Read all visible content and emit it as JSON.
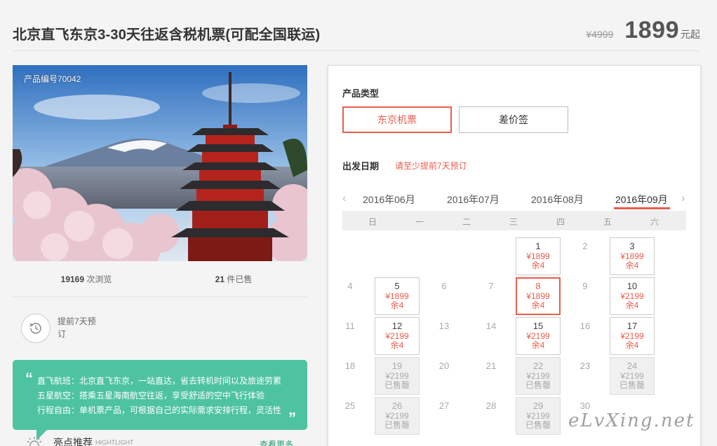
{
  "header": {
    "title": "北京直飞东京3-30天往返含税机票(可配全国联运)",
    "old_price": "¥4999",
    "price": "1899",
    "price_unit": "元起"
  },
  "product": {
    "code_label": "产品编号70042",
    "views_count": "19169",
    "views_label": " 次浏览",
    "sold_count": "21",
    "sold_label": " 件已售",
    "advance_text": "提前7天预订"
  },
  "highlights": {
    "lines": [
      "直飞航班：北京直飞东京，一站直达，省去转机时间以及旅途劳累",
      "五星航空：搭乘五星海南航空往返，享受舒适的空中飞行体验",
      "行程自由：单机票产品，可根据自己的实际需求安排行程，灵活性"
    ],
    "section_title": "亮点推荐",
    "section_en": "HIGHTLIGHT",
    "see_more": "查看更多"
  },
  "booking": {
    "type_label": "产品类型",
    "types": [
      {
        "label": "东京机票",
        "active": true
      },
      {
        "label": "差价签",
        "active": false
      }
    ],
    "date_label": "出发日期",
    "date_note": "请至少提前7天预订",
    "months": [
      "2016年06月",
      "2016年07月",
      "2016年08月",
      "2016年09月"
    ],
    "active_month": "2016年09月",
    "weekdays": [
      "日",
      "一",
      "二",
      "三",
      "四",
      "五",
      "六"
    ],
    "days": [
      {
        "d": "1",
        "col": 4,
        "row": 0,
        "state": "avail",
        "price": "¥1899",
        "left": "余4"
      },
      {
        "d": "2",
        "col": 5,
        "row": 0,
        "state": "plain"
      },
      {
        "d": "3",
        "col": 6,
        "row": 0,
        "state": "avail",
        "price": "¥1899",
        "left": "余4"
      },
      {
        "d": "4",
        "col": 0,
        "row": 1,
        "state": "plain"
      },
      {
        "d": "5",
        "col": 1,
        "row": 1,
        "state": "avail",
        "price": "¥1899",
        "left": "余4"
      },
      {
        "d": "6",
        "col": 2,
        "row": 1,
        "state": "plain"
      },
      {
        "d": "7",
        "col": 3,
        "row": 1,
        "state": "plain"
      },
      {
        "d": "8",
        "col": 4,
        "row": 1,
        "state": "selected",
        "price": "¥1899",
        "left": "余4"
      },
      {
        "d": "9",
        "col": 5,
        "row": 1,
        "state": "plain"
      },
      {
        "d": "10",
        "col": 6,
        "row": 1,
        "state": "avail",
        "price": "¥2199",
        "left": "余4"
      },
      {
        "d": "11",
        "col": 0,
        "row": 2,
        "state": "plain"
      },
      {
        "d": "12",
        "col": 1,
        "row": 2,
        "state": "avail",
        "price": "¥2199",
        "left": "余4"
      },
      {
        "d": "13",
        "col": 2,
        "row": 2,
        "state": "plain"
      },
      {
        "d": "14",
        "col": 3,
        "row": 2,
        "state": "plain"
      },
      {
        "d": "15",
        "col": 4,
        "row": 2,
        "state": "avail",
        "price": "¥2199",
        "left": "余4"
      },
      {
        "d": "16",
        "col": 5,
        "row": 2,
        "state": "plain"
      },
      {
        "d": "17",
        "col": 6,
        "row": 2,
        "state": "avail",
        "price": "¥2199",
        "left": "余4"
      },
      {
        "d": "18",
        "col": 0,
        "row": 3,
        "state": "plain"
      },
      {
        "d": "19",
        "col": 1,
        "row": 3,
        "state": "soldout",
        "price": "¥2199",
        "left": "已售罄"
      },
      {
        "d": "20",
        "col": 2,
        "row": 3,
        "state": "plain"
      },
      {
        "d": "21",
        "col": 3,
        "row": 3,
        "state": "plain"
      },
      {
        "d": "22",
        "col": 4,
        "row": 3,
        "state": "soldout",
        "price": "¥2199",
        "left": "已售罄"
      },
      {
        "d": "23",
        "col": 5,
        "row": 3,
        "state": "plain"
      },
      {
        "d": "24",
        "col": 6,
        "row": 3,
        "state": "soldout",
        "price": "¥2199",
        "left": "已售罄"
      },
      {
        "d": "25",
        "col": 0,
        "row": 4,
        "state": "plain"
      },
      {
        "d": "26",
        "col": 1,
        "row": 4,
        "state": "soldout",
        "price": "¥2199",
        "left": "已售罄"
      },
      {
        "d": "27",
        "col": 2,
        "row": 4,
        "state": "plain"
      },
      {
        "d": "28",
        "col": 3,
        "row": 4,
        "state": "plain"
      },
      {
        "d": "29",
        "col": 4,
        "row": 4,
        "state": "soldout",
        "price": "¥2199",
        "left": "已售罄"
      },
      {
        "d": "30",
        "col": 5,
        "row": 4,
        "state": "plain"
      }
    ]
  },
  "watermark": "eLvXing.net",
  "colors": {
    "accent": "#e95d4c",
    "green": "#4ec3a1",
    "link": "#2a9d76"
  }
}
